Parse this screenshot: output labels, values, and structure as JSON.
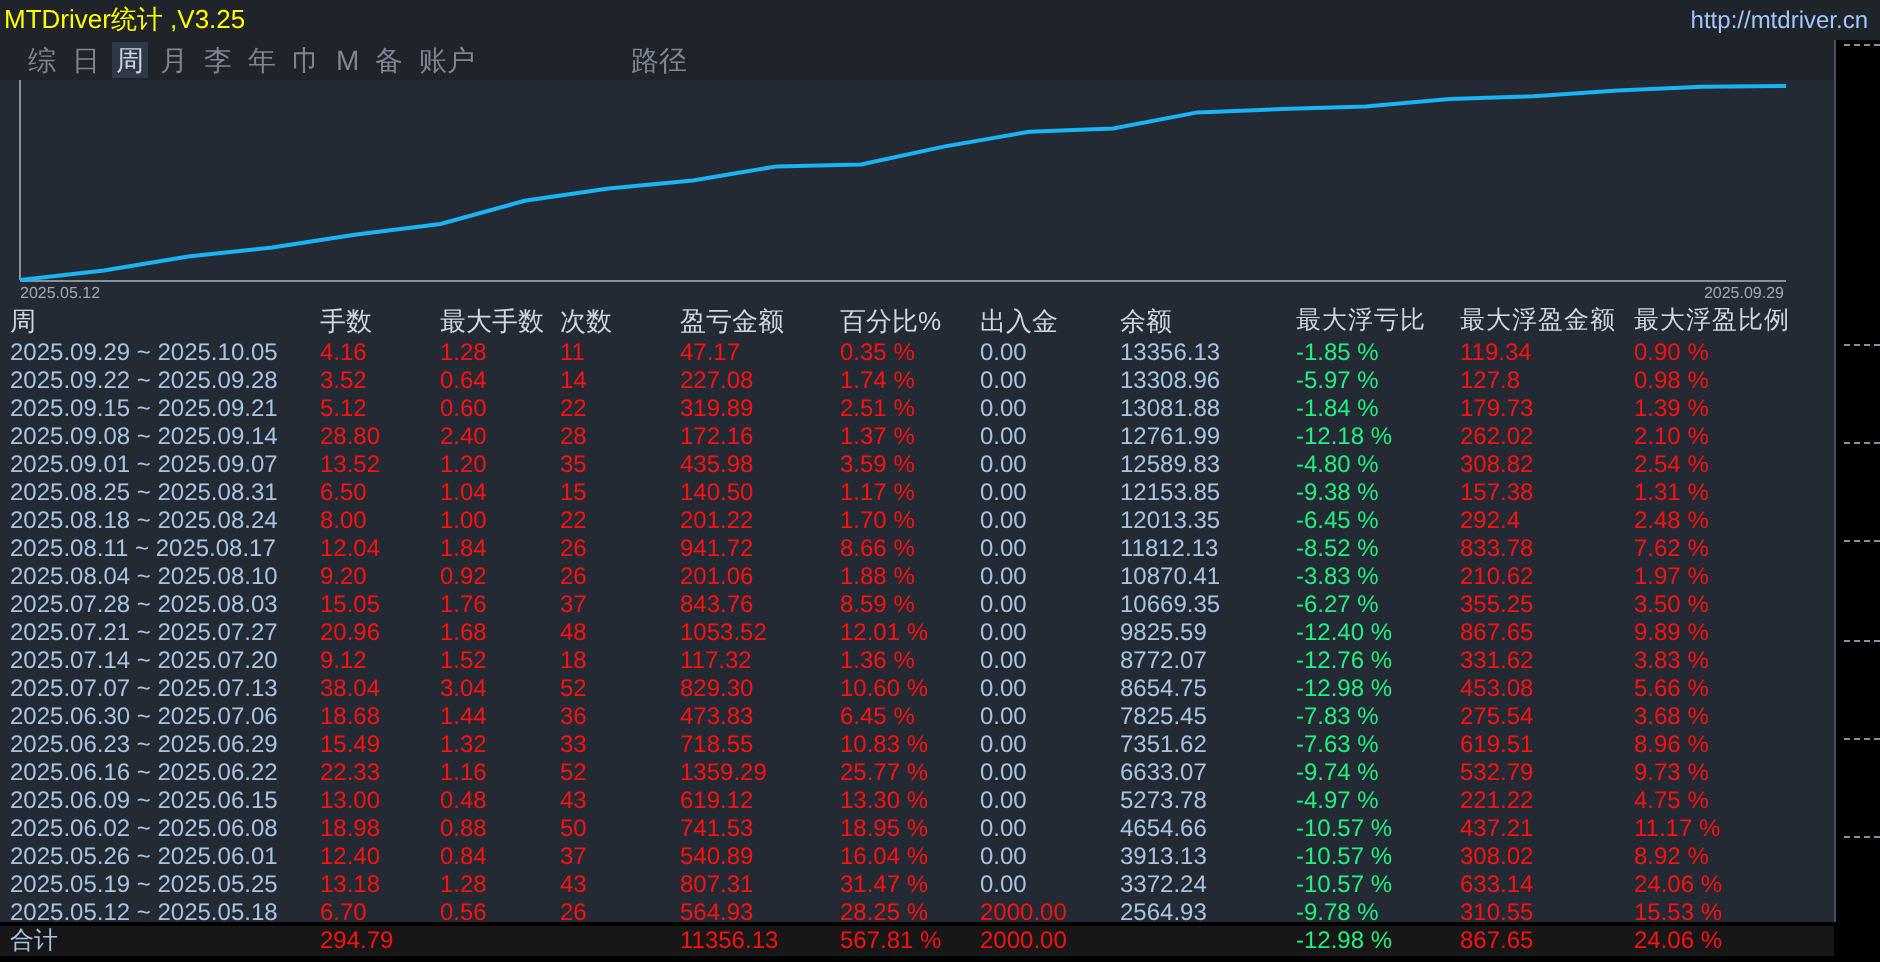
{
  "window": {
    "title": "MTDriver统计 ,V3.25",
    "url": "http://mtdriver.cn"
  },
  "tabs": [
    {
      "label": "综",
      "selected": false
    },
    {
      "label": "日",
      "selected": false
    },
    {
      "label": "周",
      "selected": true
    },
    {
      "label": "月",
      "selected": false
    },
    {
      "label": "李",
      "selected": false
    },
    {
      "label": "年",
      "selected": false
    },
    {
      "label": "巾",
      "selected": false
    },
    {
      "label": "M",
      "selected": false
    },
    {
      "label": "备",
      "selected": false
    },
    {
      "label": "账户",
      "selected": false
    },
    {
      "label": "路径",
      "selected": false
    }
  ],
  "chart": {
    "start_label": "2025.05.12",
    "end_label": "2025.09.29"
  },
  "table": {
    "columns": [
      "周",
      "手数",
      "最大手数",
      "次数",
      "盈亏金额",
      "百分比%",
      "出入金",
      "余额",
      "最大浮亏比",
      "最大浮盈金额",
      "最大浮盈比例"
    ],
    "rows": [
      {
        "period": "2025.09.29 ~ 2025.10.05",
        "lots": "4.16",
        "max_lots": "1.28",
        "count": "11",
        "pnl": "47.17",
        "pct": "0.35 %",
        "deposit": "0.00",
        "balance": "13356.13",
        "max_float_loss_pct": "-1.85 %",
        "max_float_profit": "119.34",
        "max_float_profit_pct": "0.90 %"
      },
      {
        "period": "2025.09.22 ~ 2025.09.28",
        "lots": "3.52",
        "max_lots": "0.64",
        "count": "14",
        "pnl": "227.08",
        "pct": "1.74 %",
        "deposit": "0.00",
        "balance": "13308.96",
        "max_float_loss_pct": "-5.97 %",
        "max_float_profit": "127.8",
        "max_float_profit_pct": "0.98 %"
      },
      {
        "period": "2025.09.15 ~ 2025.09.21",
        "lots": "5.12",
        "max_lots": "0.60",
        "count": "22",
        "pnl": "319.89",
        "pct": "2.51 %",
        "deposit": "0.00",
        "balance": "13081.88",
        "max_float_loss_pct": "-1.84 %",
        "max_float_profit": "179.73",
        "max_float_profit_pct": "1.39 %"
      },
      {
        "period": "2025.09.08 ~ 2025.09.14",
        "lots": "28.80",
        "max_lots": "2.40",
        "count": "28",
        "pnl": "172.16",
        "pct": "1.37 %",
        "deposit": "0.00",
        "balance": "12761.99",
        "max_float_loss_pct": "-12.18 %",
        "max_float_profit": "262.02",
        "max_float_profit_pct": "2.10 %"
      },
      {
        "period": "2025.09.01 ~ 2025.09.07",
        "lots": "13.52",
        "max_lots": "1.20",
        "count": "35",
        "pnl": "435.98",
        "pct": "3.59 %",
        "deposit": "0.00",
        "balance": "12589.83",
        "max_float_loss_pct": "-4.80 %",
        "max_float_profit": "308.82",
        "max_float_profit_pct": "2.54 %"
      },
      {
        "period": "2025.08.25 ~ 2025.08.31",
        "lots": "6.50",
        "max_lots": "1.04",
        "count": "15",
        "pnl": "140.50",
        "pct": "1.17 %",
        "deposit": "0.00",
        "balance": "12153.85",
        "max_float_loss_pct": "-9.38 %",
        "max_float_profit": "157.38",
        "max_float_profit_pct": "1.31 %"
      },
      {
        "period": "2025.08.18 ~ 2025.08.24",
        "lots": "8.00",
        "max_lots": "1.00",
        "count": "22",
        "pnl": "201.22",
        "pct": "1.70 %",
        "deposit": "0.00",
        "balance": "12013.35",
        "max_float_loss_pct": "-6.45 %",
        "max_float_profit": "292.4",
        "max_float_profit_pct": "2.48 %"
      },
      {
        "period": "2025.08.11 ~ 2025.08.17",
        "lots": "12.04",
        "max_lots": "1.84",
        "count": "26",
        "pnl": "941.72",
        "pct": "8.66 %",
        "deposit": "0.00",
        "balance": "11812.13",
        "max_float_loss_pct": "-8.52 %",
        "max_float_profit": "833.78",
        "max_float_profit_pct": "7.62 %"
      },
      {
        "period": "2025.08.04 ~ 2025.08.10",
        "lots": "9.20",
        "max_lots": "0.92",
        "count": "26",
        "pnl": "201.06",
        "pct": "1.88 %",
        "deposit": "0.00",
        "balance": "10870.41",
        "max_float_loss_pct": "-3.83 %",
        "max_float_profit": "210.62",
        "max_float_profit_pct": "1.97 %"
      },
      {
        "period": "2025.07.28 ~ 2025.08.03",
        "lots": "15.05",
        "max_lots": "1.76",
        "count": "37",
        "pnl": "843.76",
        "pct": "8.59 %",
        "deposit": "0.00",
        "balance": "10669.35",
        "max_float_loss_pct": "-6.27 %",
        "max_float_profit": "355.25",
        "max_float_profit_pct": "3.50 %"
      },
      {
        "period": "2025.07.21 ~ 2025.07.27",
        "lots": "20.96",
        "max_lots": "1.68",
        "count": "48",
        "pnl": "1053.52",
        "pct": "12.01 %",
        "deposit": "0.00",
        "balance": "9825.59",
        "max_float_loss_pct": "-12.40 %",
        "max_float_profit": "867.65",
        "max_float_profit_pct": "9.89 %"
      },
      {
        "period": "2025.07.14 ~ 2025.07.20",
        "lots": "9.12",
        "max_lots": "1.52",
        "count": "18",
        "pnl": "117.32",
        "pct": "1.36 %",
        "deposit": "0.00",
        "balance": "8772.07",
        "max_float_loss_pct": "-12.76 %",
        "max_float_profit": "331.62",
        "max_float_profit_pct": "3.83 %"
      },
      {
        "period": "2025.07.07 ~ 2025.07.13",
        "lots": "38.04",
        "max_lots": "3.04",
        "count": "52",
        "pnl": "829.30",
        "pct": "10.60 %",
        "deposit": "0.00",
        "balance": "8654.75",
        "max_float_loss_pct": "-12.98 %",
        "max_float_profit": "453.08",
        "max_float_profit_pct": "5.66 %"
      },
      {
        "period": "2025.06.30 ~ 2025.07.06",
        "lots": "18.68",
        "max_lots": "1.44",
        "count": "36",
        "pnl": "473.83",
        "pct": "6.45 %",
        "deposit": "0.00",
        "balance": "7825.45",
        "max_float_loss_pct": "-7.83 %",
        "max_float_profit": "275.54",
        "max_float_profit_pct": "3.68 %"
      },
      {
        "period": "2025.06.23 ~ 2025.06.29",
        "lots": "15.49",
        "max_lots": "1.32",
        "count": "33",
        "pnl": "718.55",
        "pct": "10.83 %",
        "deposit": "0.00",
        "balance": "7351.62",
        "max_float_loss_pct": "-7.63 %",
        "max_float_profit": "619.51",
        "max_float_profit_pct": "8.96 %"
      },
      {
        "period": "2025.06.16 ~ 2025.06.22",
        "lots": "22.33",
        "max_lots": "1.16",
        "count": "52",
        "pnl": "1359.29",
        "pct": "25.77 %",
        "deposit": "0.00",
        "balance": "6633.07",
        "max_float_loss_pct": "-9.74 %",
        "max_float_profit": "532.79",
        "max_float_profit_pct": "9.73 %"
      },
      {
        "period": "2025.06.09 ~ 2025.06.15",
        "lots": "13.00",
        "max_lots": "0.48",
        "count": "43",
        "pnl": "619.12",
        "pct": "13.30 %",
        "deposit": "0.00",
        "balance": "5273.78",
        "max_float_loss_pct": "-4.97 %",
        "max_float_profit": "221.22",
        "max_float_profit_pct": "4.75 %"
      },
      {
        "period": "2025.06.02 ~ 2025.06.08",
        "lots": "18.98",
        "max_lots": "0.88",
        "count": "50",
        "pnl": "741.53",
        "pct": "18.95 %",
        "deposit": "0.00",
        "balance": "4654.66",
        "max_float_loss_pct": "-10.57 %",
        "max_float_profit": "437.21",
        "max_float_profit_pct": "11.17 %"
      },
      {
        "period": "2025.05.26 ~ 2025.06.01",
        "lots": "12.40",
        "max_lots": "0.84",
        "count": "37",
        "pnl": "540.89",
        "pct": "16.04 %",
        "deposit": "0.00",
        "balance": "3913.13",
        "max_float_loss_pct": "-10.57 %",
        "max_float_profit": "308.02",
        "max_float_profit_pct": "8.92 %"
      },
      {
        "period": "2025.05.19 ~ 2025.05.25",
        "lots": "13.18",
        "max_lots": "1.28",
        "count": "43",
        "pnl": "807.31",
        "pct": "31.47 %",
        "deposit": "0.00",
        "balance": "3372.24",
        "max_float_loss_pct": "-10.57 %",
        "max_float_profit": "633.14",
        "max_float_profit_pct": "24.06 %"
      },
      {
        "period": "2025.05.12 ~ 2025.05.18",
        "lots": "6.70",
        "max_lots": "0.56",
        "count": "26",
        "pnl": "564.93",
        "pct": "28.25 %",
        "deposit": "2000.00",
        "balance": "2564.93",
        "max_float_loss_pct": "-9.78 %",
        "max_float_profit": "310.55",
        "max_float_profit_pct": "15.53 %"
      }
    ],
    "total": {
      "period": "合计",
      "lots": "294.79",
      "pnl": "11356.13",
      "pct": "567.81 %",
      "deposit": "2000.00",
      "max_float_loss_pct": "-12.98 %",
      "max_float_profit": "867.65",
      "max_float_profit_pct": "24.06 %"
    }
  }
}
